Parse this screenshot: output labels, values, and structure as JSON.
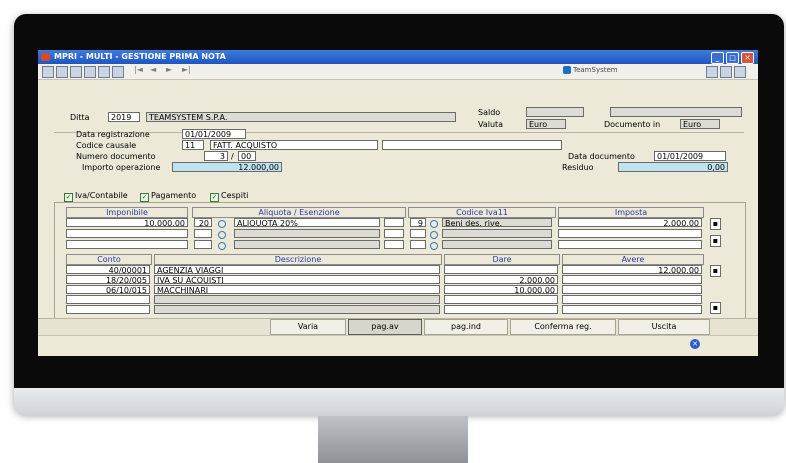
{
  "window": {
    "title": "MPRI - MULTI - GESTIONE PRIMA NOTA",
    "brand": "TeamSystem"
  },
  "toolbar": {
    "nav": [
      "|◄",
      "◄",
      "►",
      "►|"
    ]
  },
  "header": {
    "ditta_label": "Ditta",
    "ditta_code": "2019",
    "ditta_name": "TEAMSYSTEM S.P.A.",
    "saldo_label": "Saldo",
    "saldo_value": "",
    "saldo_value2": "",
    "valuta_label": "Valuta",
    "valuta_value": "Euro",
    "documento_in_label": "Documento in",
    "documento_in_value": "Euro",
    "data_registrazione_label": "Data registrazione",
    "data_registrazione_value": "01/01/2009",
    "codice_causale_label": "Codice causale",
    "codice_causale_code": "11",
    "codice_causale_desc": "FATT. ACQUISTO",
    "numero_documento_label": "Numero documento",
    "numero_documento_value": "3",
    "numero_documento_sep": "/",
    "numero_documento_suffix": "00",
    "data_documento_label": "Data documento",
    "data_documento_value": "01/01/2009",
    "importo_label": "Importo operazione",
    "importo_value": "12.000,00",
    "residuo_label": "Residuo",
    "residuo_value": "0,00"
  },
  "tabs": [
    {
      "label": "Iva/Contabile"
    },
    {
      "label": "Pagamento"
    },
    {
      "label": "Cespiti"
    }
  ],
  "iva_table": {
    "headers": [
      "Imponibile",
      "Aliquota / Esenzione",
      "Codice Iva11",
      "Imposta"
    ],
    "row": {
      "imponibile": "10.000,00",
      "aliquota_code": "20",
      "aliquota_desc": "ALIQUOTA 20%",
      "codice_iva": "9",
      "codice_iva_desc": "Beni des. rive.",
      "imposta": "2.000,00"
    }
  },
  "conti_table": {
    "headers": [
      "Conto",
      "Descrizione",
      "Dare",
      "Avere"
    ],
    "rows": [
      {
        "conto": "40/00001",
        "descrizione": "AGENZIA VIAGGI",
        "dare": "",
        "avere": "12.000,00"
      },
      {
        "conto": "18/20/005",
        "descrizione": "IVA SU ACQUISTI",
        "dare": "2.000,00",
        "avere": ""
      },
      {
        "conto": "06/10/015",
        "descrizione": "MACCHINARI",
        "dare": "10.000,00",
        "avere": ""
      }
    ]
  },
  "buttons": {
    "varia": "Varia",
    "pag_av": "pag.av",
    "pag_ind": "pag.ind",
    "conferma": "Conferma reg.",
    "uscita": "Uscita"
  }
}
